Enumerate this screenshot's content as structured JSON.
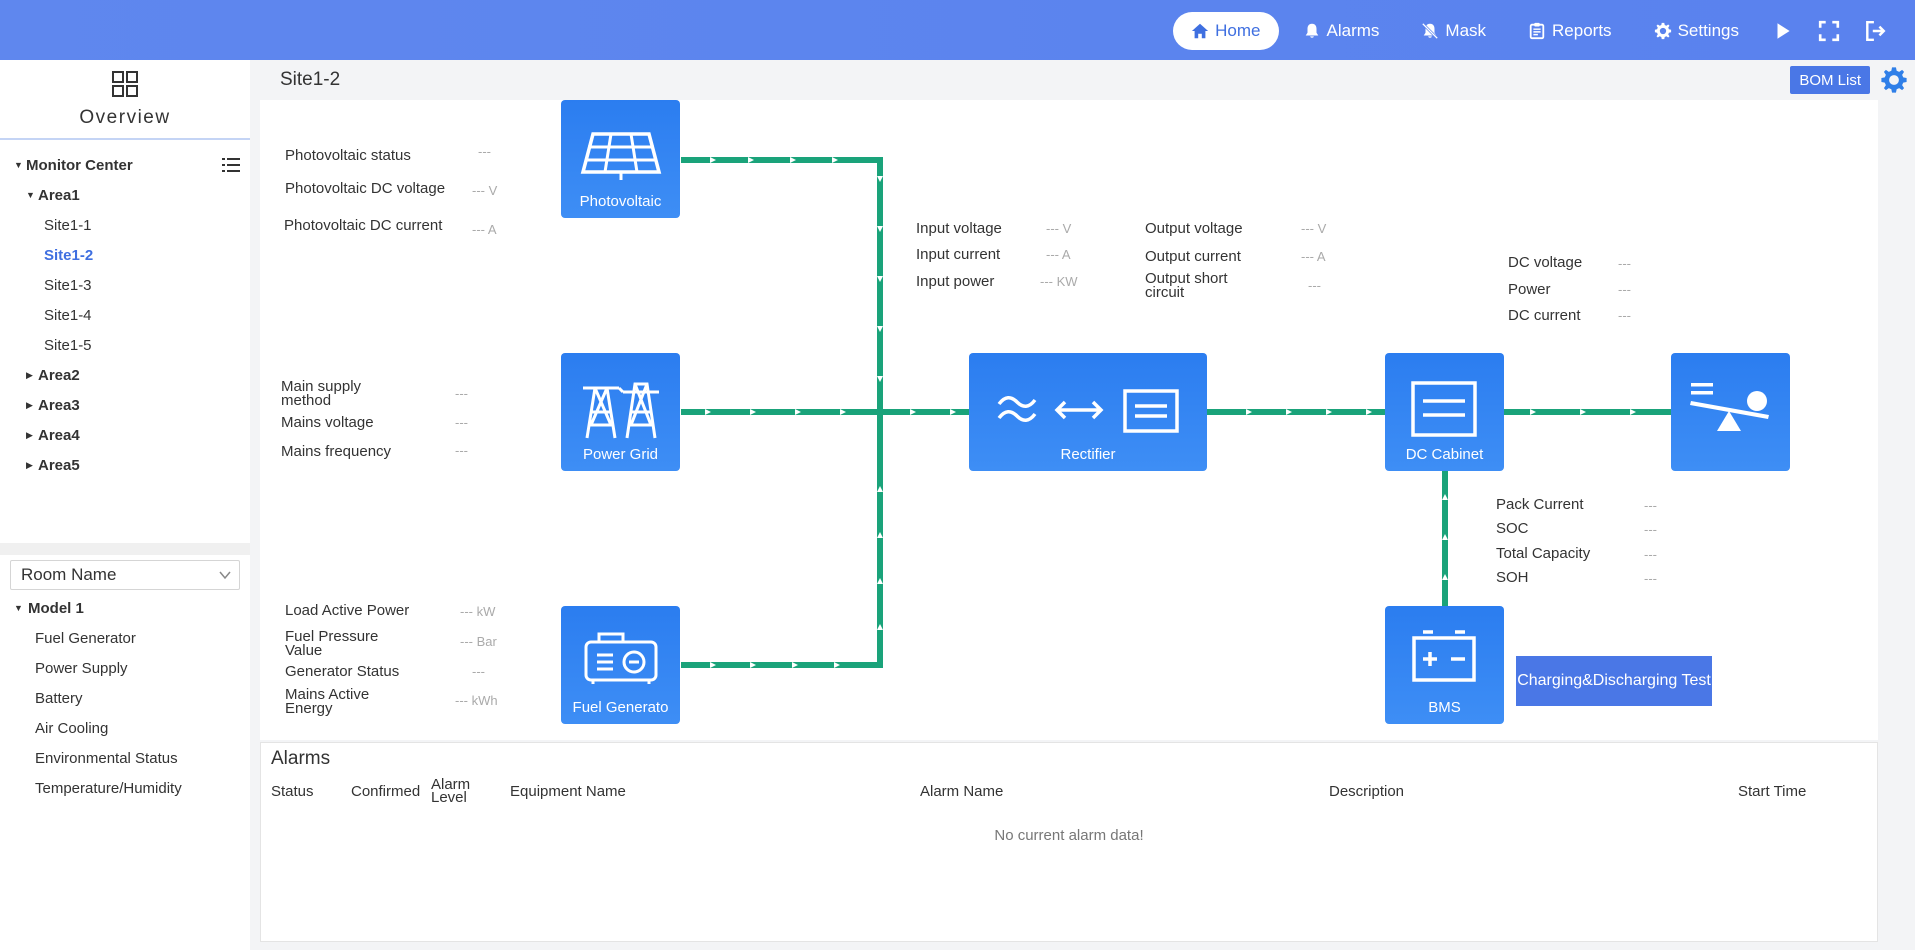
{
  "nav": {
    "home": "Home",
    "alarms": "Alarms",
    "mask": "Mask",
    "reports": "Reports",
    "settings": "Settings"
  },
  "sidebar": {
    "overview": "Overview",
    "monitor_center": "Monitor Center",
    "area1": "Area1",
    "sites": [
      "Site1-1",
      "Site1-2",
      "Site1-3",
      "Site1-4",
      "Site1-5"
    ],
    "areas": [
      "Area2",
      "Area3",
      "Area4",
      "Area5"
    ],
    "room_placeholder": "Room Name",
    "model": "Model 1",
    "model_items": [
      "Fuel Generator",
      "Power Supply",
      "Battery",
      "Air Cooling",
      "Environmental Status",
      "Temperature/Humidity"
    ]
  },
  "breadcrumb": "Site1-2",
  "bom_list": "BOM List",
  "devices": {
    "photovoltaic": "Photovoltaic",
    "power_grid": "Power Grid",
    "fuel_generator": "Fuel Generato",
    "rectifier": "Rectifier",
    "dc_cabinet": "DC Cabinet",
    "bms": "BMS"
  },
  "pv": {
    "status_label": "Photovoltaic status",
    "status_value": "---",
    "voltage_label": "Photovoltaic DC voltage",
    "voltage_value": "--- V",
    "current_label": "Photovoltaic DC current",
    "current_value": "--- A"
  },
  "grid": {
    "method_label": "Main supply method",
    "method_value": "---",
    "voltage_label": "Mains voltage",
    "voltage_value": "---",
    "frequency_label": "Mains frequency",
    "frequency_value": "---"
  },
  "generator": {
    "load_label": "Load Active Power",
    "load_value": "--- kW",
    "fuel_label": "Fuel Pressure Value",
    "fuel_value": "--- Bar",
    "status_label": "Generator Status",
    "status_value": "---",
    "energy_label": "Mains Active Energy",
    "energy_value": "--- kWh"
  },
  "rectifier_data": {
    "in_voltage_label": "Input voltage",
    "in_voltage_value": "--- V",
    "in_current_label": "Input current",
    "in_current_value": "--- A",
    "in_power_label": "Input power",
    "in_power_value": "--- KW",
    "out_voltage_label": "Output voltage",
    "out_voltage_value": "--- V",
    "out_current_label": "Output current",
    "out_current_value": "--- A",
    "out_short_label": "Output short circuit",
    "out_short_value": "---"
  },
  "dc_data": {
    "voltage_label": "DC voltage",
    "voltage_value": "---",
    "power_label": "Power",
    "power_value": "---",
    "current_label": "DC current",
    "current_value": "---"
  },
  "bms_data": {
    "pack_label": "Pack Current",
    "pack_value": "---",
    "soc_label": "SOC",
    "soc_value": "---",
    "cap_label": "Total Capacity",
    "cap_value": "---",
    "soh_label": "SOH",
    "soh_value": "---"
  },
  "charging_test": "Charging&Discharging Test",
  "alarms": {
    "title": "Alarms",
    "columns": [
      "Status",
      "Confirmed",
      "Alarm Level",
      "Equipment Name",
      "Alarm Name",
      "Description",
      "Start Time"
    ],
    "empty": "No current alarm data!"
  },
  "colors": {
    "accent": "#4a77e6",
    "line": "#1aa37a",
    "box": "#2f82f2"
  }
}
